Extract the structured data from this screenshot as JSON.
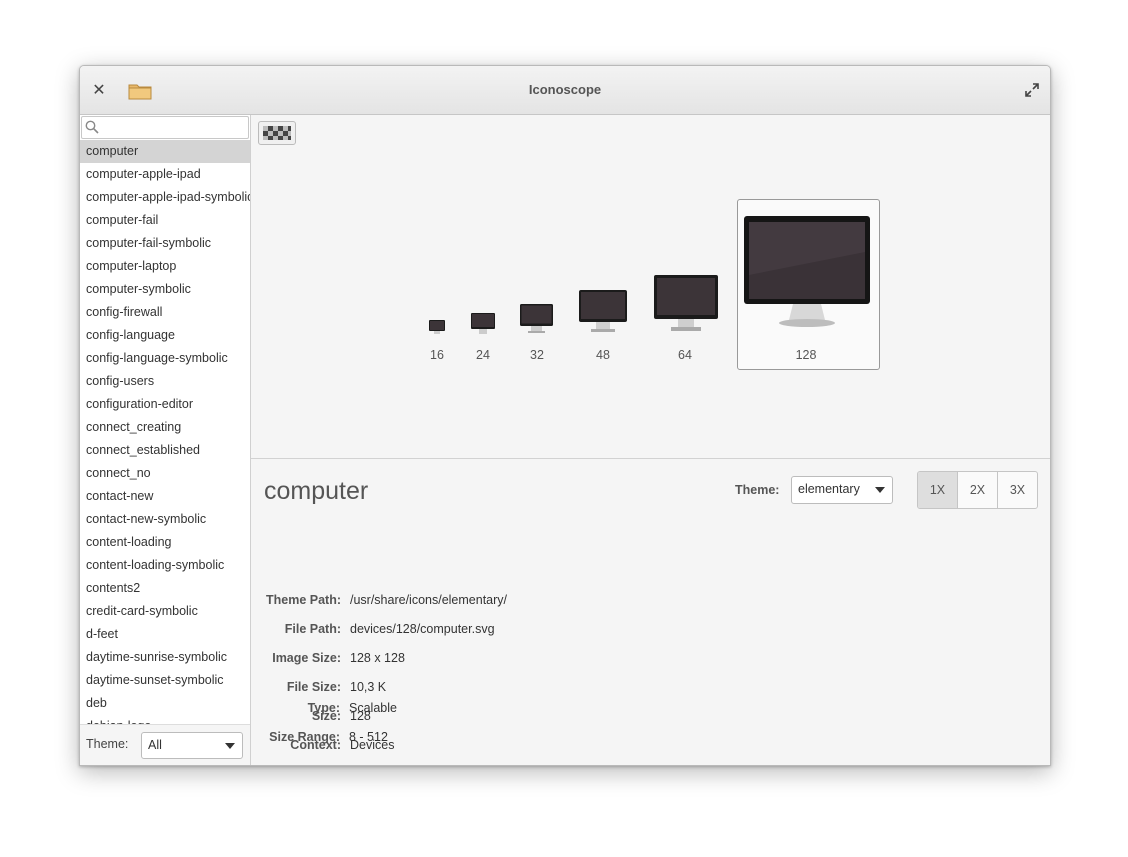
{
  "window": {
    "title": "Iconoscope"
  },
  "icons": {
    "close": "close-icon",
    "folder": "folder-icon",
    "maximize": "maximize-icon",
    "search": "search-icon",
    "checkerboard": "checkerboard-icon"
  },
  "sidebar": {
    "search_placeholder": "",
    "items": [
      "computer",
      "computer-apple-ipad",
      "computer-apple-ipad-symbolic",
      "computer-fail",
      "computer-fail-symbolic",
      "computer-laptop",
      "computer-symbolic",
      "config-firewall",
      "config-language",
      "config-language-symbolic",
      "config-users",
      "configuration-editor",
      "connect_creating",
      "connect_established",
      "connect_no",
      "contact-new",
      "contact-new-symbolic",
      "content-loading",
      "content-loading-symbolic",
      "contents2",
      "credit-card-symbolic",
      "d-feet",
      "daytime-sunrise-symbolic",
      "daytime-sunset-symbolic",
      "deb",
      "debian-logo"
    ],
    "selected_index": 0,
    "theme_label": "Theme:",
    "theme_value": "All"
  },
  "preview": {
    "sizes": [
      "16",
      "24",
      "32",
      "48",
      "64",
      "128"
    ],
    "selected_size": "128"
  },
  "details": {
    "name": "computer",
    "theme_label": "Theme:",
    "theme_value": "elementary",
    "scale_buttons": [
      "1X",
      "2X",
      "3X"
    ],
    "active_scale": "1X",
    "properties": [
      {
        "key": "Theme Path:",
        "value": "/usr/share/icons/elementary/"
      },
      {
        "key": "File Path:",
        "value": "devices/128/computer.svg"
      },
      {
        "key": "Image Size:",
        "value": "128 x 128"
      },
      {
        "key": "File Size:",
        "value": "10,3 K"
      },
      {
        "key": "Size:",
        "value": "128"
      },
      {
        "key": "Context:",
        "value": "Devices"
      },
      {
        "key": "Type:",
        "value": "Scalable"
      },
      {
        "key": "Size Range:",
        "value": "8 - 512"
      }
    ]
  }
}
